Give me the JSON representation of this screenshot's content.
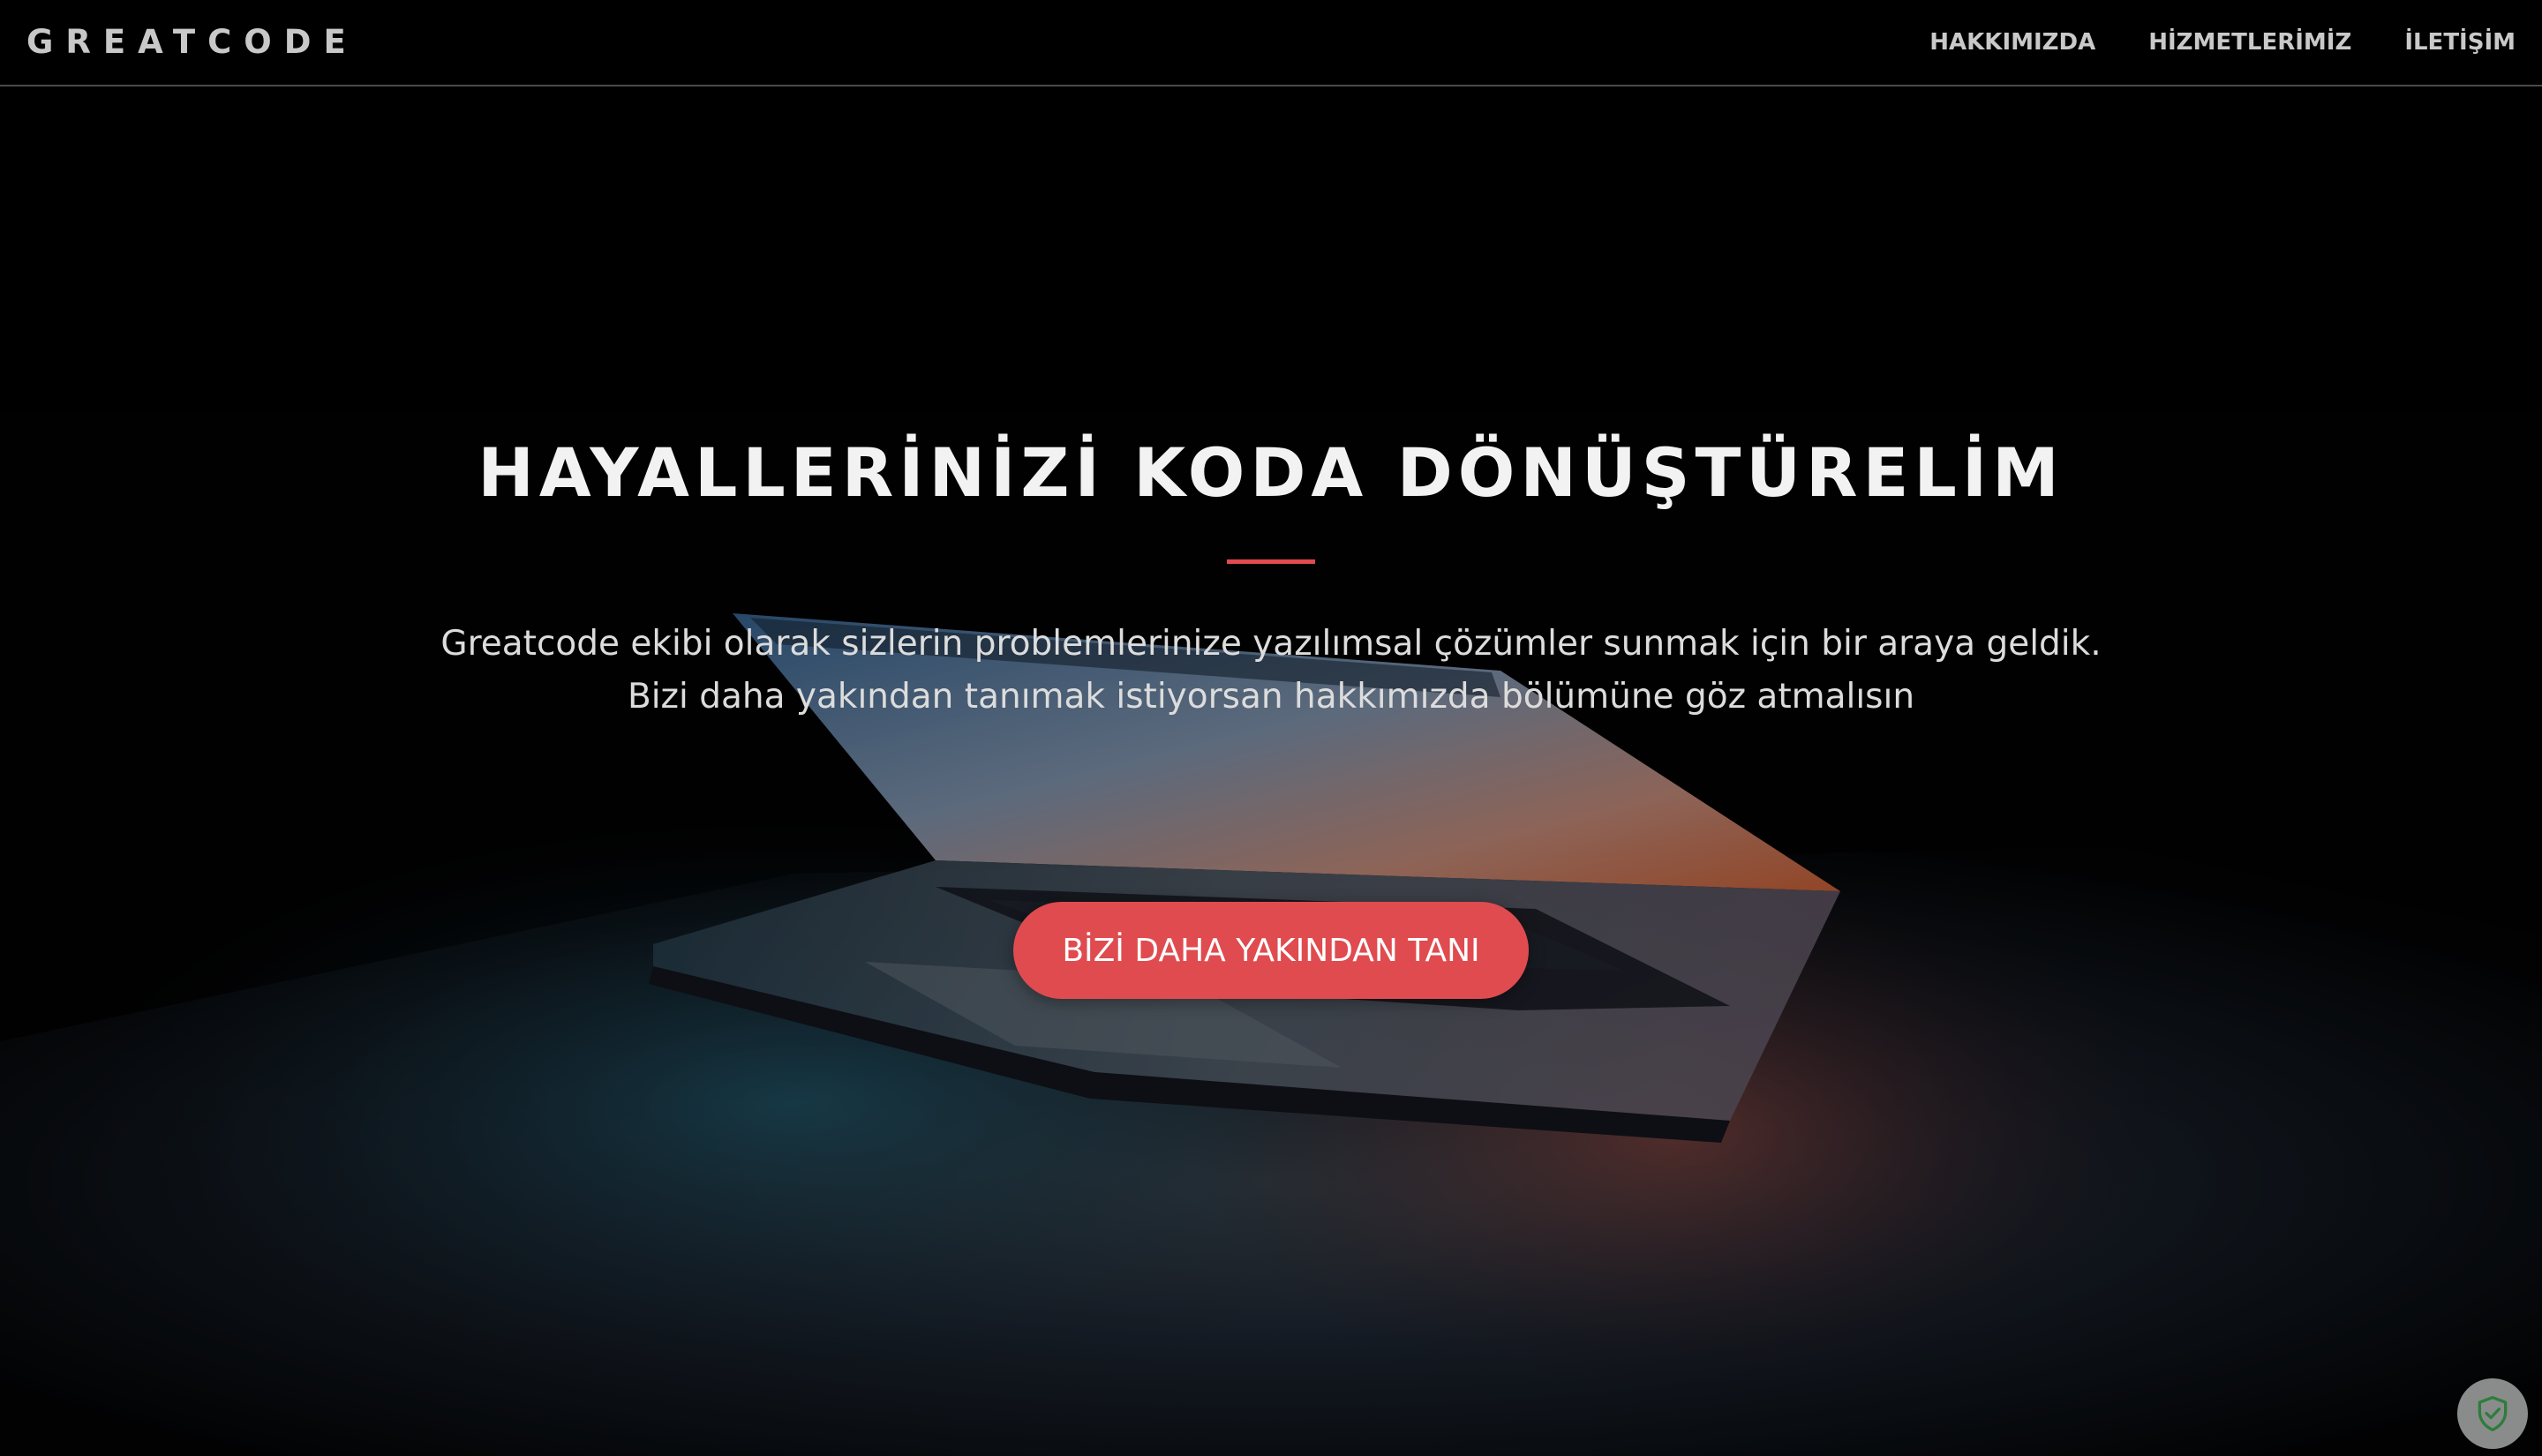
{
  "navbar": {
    "brand": "GREATCODE",
    "links": [
      {
        "label": "HAKKIMIZDA"
      },
      {
        "label": "HİZMETLERİMİZ"
      },
      {
        "label": "İLETİŞİM"
      }
    ]
  },
  "hero": {
    "title": "HAYALLERİNİZİ KODA DÖNÜŞTÜRELİM",
    "lines": [
      "Greatcode ekibi olarak sizlerin problemlerinize yazılımsal çözümler sunmak için bir araya geldik.",
      "Bizi daha yakından tanımak istiyorsan hakkımızda bölümüne göz atmalısın"
    ],
    "cta_label": "BİZİ DAHA YAKINDAN TANI"
  },
  "colors": {
    "accent": "#df4b4f",
    "navbar_bg": "#000000",
    "text_light": "#f2f2f2",
    "badge_bg": "#8a8c8c",
    "badge_icon": "#2e7d3a"
  },
  "icons": {
    "badge": "shield-check-icon"
  }
}
